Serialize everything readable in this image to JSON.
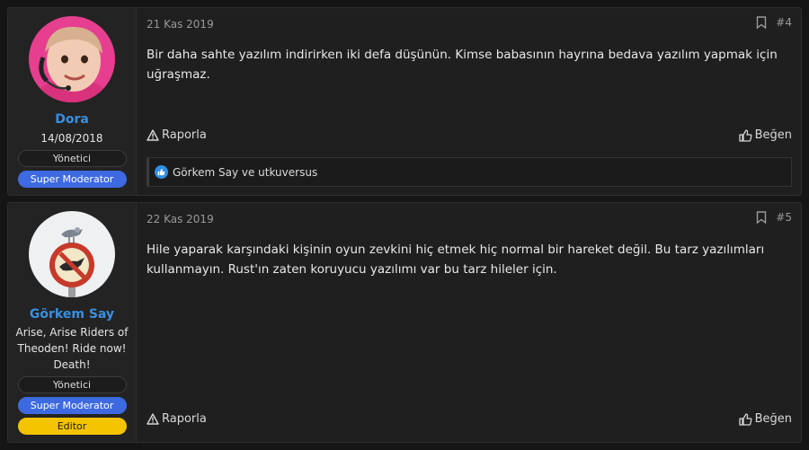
{
  "posts": [
    {
      "date": "21 Kas 2019",
      "number": "#4",
      "text": "Bir daha sahte yazılım indirirken iki defa düşünün. Kimse babasının hayrına bedava yazılım yapmak için uğraşmaz.",
      "user": {
        "name": "Dora",
        "date": "14/08/2018",
        "roles": [
          "Yönetici",
          "Super Moderator"
        ]
      },
      "report_label": "Raporla",
      "like_label": "Beğen",
      "reactions_text": "Görkem Say ve utkuversus"
    },
    {
      "date": "22 Kas 2019",
      "number": "#5",
      "text": "Hile yaparak karşındaki kişinin oyun zevkini hiç etmek hiç normal bir hareket değil. Bu tarz yazılımları kullanmayın. Rust'ın zaten koruyucu yazılımı var bu tarz hileler için.",
      "user": {
        "name": "Görkem Say",
        "title": "Arise, Arise Riders of Theoden! Ride now! Death!",
        "roles": [
          "Yönetici",
          "Super Moderator",
          "Editor"
        ]
      },
      "report_label": "Raporla",
      "like_label": "Beğen"
    }
  ],
  "icons": {
    "bookmark": "bookmark-icon",
    "report": "warning-triangle-icon",
    "like": "thumbs-up-icon"
  },
  "colors": {
    "username": "#3a8fe0",
    "super_moderator": "#3e6ae1",
    "editor": "#f5c400",
    "like_reaction": "#2f8fe6"
  }
}
